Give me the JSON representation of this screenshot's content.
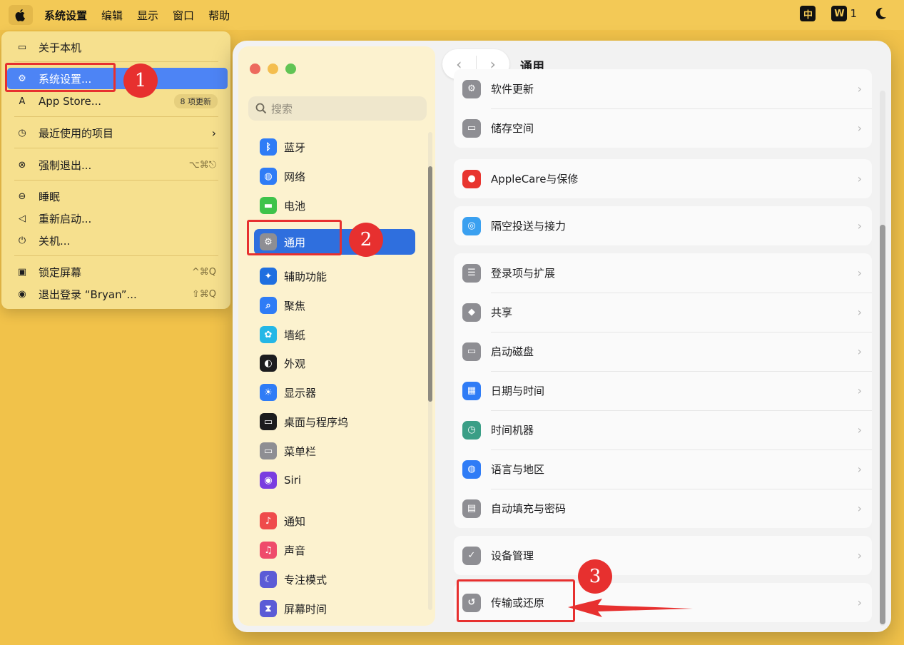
{
  "menubar": {
    "app_name": "系统设置",
    "items": [
      "编辑",
      "显示",
      "窗口",
      "帮助"
    ],
    "right": {
      "input_method": "中",
      "wps_badge": "W",
      "wps_count": "1"
    }
  },
  "apple_menu": {
    "about": "关于本机",
    "settings": "系统设置...",
    "appstore": "App Store...",
    "appstore_badge": "8 项更新",
    "recent": "最近使用的项目",
    "force_quit": "强制退出...",
    "force_quit_short": "⌥⌘⎋",
    "sleep": "睡眠",
    "restart": "重新启动...",
    "shutdown": "关机...",
    "lock": "锁定屏幕",
    "lock_short": "^⌘Q",
    "logout": "退出登录 “Bryan”...",
    "logout_short": "⇧⌘Q"
  },
  "sidebar": {
    "search_placeholder": "搜索",
    "items": [
      {
        "label": "蓝牙",
        "icon": "bluetooth-icon",
        "color": "#2f7cf6"
      },
      {
        "label": "网络",
        "icon": "globe-icon",
        "color": "#2f7cf6"
      },
      {
        "label": "电池",
        "icon": "battery-icon",
        "color": "#3ec34a"
      },
      {
        "label": "通用",
        "icon": "gear-icon",
        "color": "#8e8e93"
      },
      {
        "label": "辅助功能",
        "icon": "accessibility-icon",
        "color": "#1f6fe0"
      },
      {
        "label": "聚焦",
        "icon": "magnifier-icon",
        "color": "#2f7cf6"
      },
      {
        "label": "墙纸",
        "icon": "flower-icon",
        "color": "#25b7e6"
      },
      {
        "label": "外观",
        "icon": "appearance-icon",
        "color": "#1c1c1e"
      },
      {
        "label": "显示器",
        "icon": "sun-icon",
        "color": "#2f7cf6"
      },
      {
        "label": "桌面与程序坞",
        "icon": "dock-icon",
        "color": "#1c1c1e"
      },
      {
        "label": "菜单栏",
        "icon": "menubar-icon",
        "color": "#8e8e93"
      },
      {
        "label": "Siri",
        "icon": "siri-icon",
        "color": "#7a3de0"
      },
      {
        "label": "通知",
        "icon": "bell-icon",
        "color": "#ef4b4b"
      },
      {
        "label": "声音",
        "icon": "speaker-icon",
        "color": "#ef4b6b"
      },
      {
        "label": "专注模式",
        "icon": "moon-icon",
        "color": "#5b5bd6"
      },
      {
        "label": "屏幕时间",
        "icon": "hourglass-icon",
        "color": "#5b5bd6"
      }
    ]
  },
  "main": {
    "title": "通用",
    "rows": [
      {
        "label": "软件更新",
        "icon": "gear-icon",
        "color": "#8e8e93"
      },
      {
        "label": "储存空间",
        "icon": "drive-icon",
        "color": "#8e8e93"
      },
      {
        "label": "AppleCare与保修",
        "icon": "apple-icon",
        "color": "#e8352f"
      },
      {
        "label": "隔空投送与接力",
        "icon": "airdrop-icon",
        "color": "#3aa0f0"
      },
      {
        "label": "登录项与扩展",
        "icon": "list-icon",
        "color": "#8e8e93"
      },
      {
        "label": "共享",
        "icon": "share-icon",
        "color": "#8e8e93"
      },
      {
        "label": "启动磁盘",
        "icon": "disk-icon",
        "color": "#8e8e93"
      },
      {
        "label": "日期与时间",
        "icon": "calendar-icon",
        "color": "#2f7cf6"
      },
      {
        "label": "时间机器",
        "icon": "timemachine-icon",
        "color": "#3a9e86"
      },
      {
        "label": "语言与地区",
        "icon": "globe-icon",
        "color": "#2f7cf6"
      },
      {
        "label": "自动填充与密码",
        "icon": "password-icon",
        "color": "#8e8e93"
      },
      {
        "label": "设备管理",
        "icon": "checkmark-icon",
        "color": "#8e8e93"
      },
      {
        "label": "传输或还原",
        "icon": "restore-icon",
        "color": "#8e8e93"
      }
    ]
  },
  "annotations": {
    "m1": "1",
    "m2": "2",
    "m3": "3",
    "color": "#e7302f"
  }
}
